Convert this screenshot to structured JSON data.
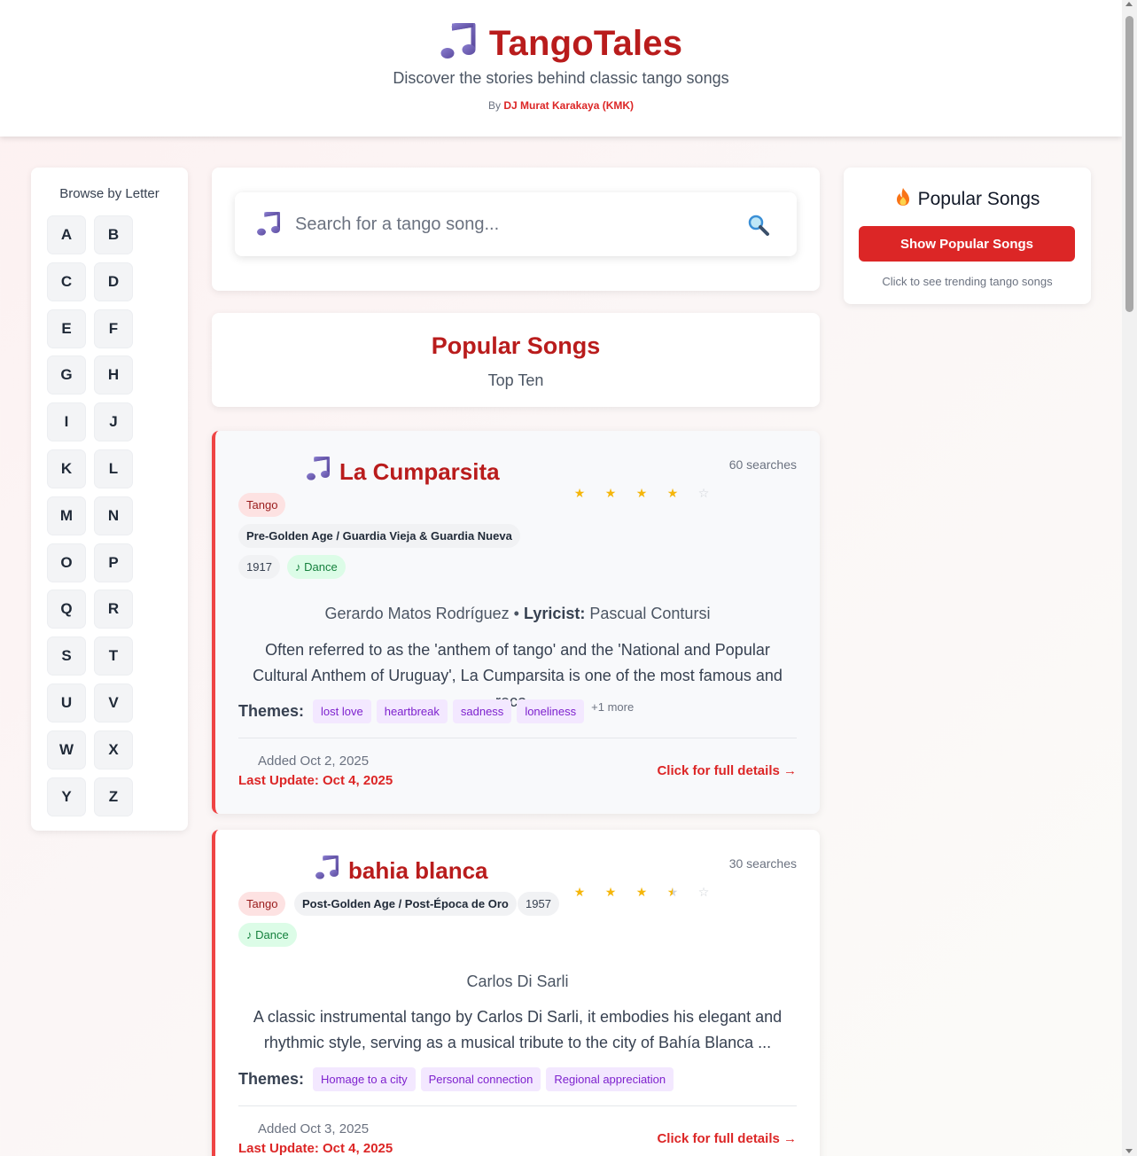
{
  "header": {
    "title": "TangoTales",
    "subtitle": "Discover the stories behind classic tango songs",
    "byline_prefix": "By",
    "author": "DJ Murat Karakaya (KMK)",
    "icon": "music-note-icon"
  },
  "letters": {
    "title": "Browse by Letter",
    "items": [
      "A",
      "B",
      "C",
      "D",
      "E",
      "F",
      "G",
      "H",
      "I",
      "J",
      "K",
      "L",
      "M",
      "N",
      "O",
      "P",
      "Q",
      "R",
      "S",
      "T",
      "U",
      "V",
      "W",
      "X",
      "Y",
      "Z"
    ]
  },
  "search": {
    "placeholder": "Search for a tango song...",
    "value": "",
    "icon": "magnifier-icon"
  },
  "popular_header": {
    "title": "Popular Songs",
    "subtitle": "Top Ten"
  },
  "songs": [
    {
      "title": "La Cumparsita",
      "searches": "60 searches",
      "rating": 4,
      "genre": "Tango",
      "era": "Pre-Golden Age / Guardia Vieja & Guardia Nueva",
      "year": "1917",
      "dance": "♪ Dance",
      "composer": "Gerardo Matos Rodríguez",
      "separator": "•",
      "lyricist_label": "Lyricist:",
      "lyricist": "Pascual Contursi",
      "description": "Often referred to as the 'anthem of tango' and the 'National and Popular Cultural Anthem of Uruguay', La Cumparsita is one of the most famous and reco...",
      "themes_label": "Themes:",
      "themes": [
        "lost love",
        "heartbreak",
        "sadness",
        "loneliness"
      ],
      "more": "+1 more",
      "added": "Added Oct 2, 2025",
      "updated": "Last Update: Oct 4, 2025",
      "details": "Click for full details →"
    },
    {
      "title": "bahia blanca",
      "searches": "30 searches",
      "rating": 3.5,
      "genre": "Tango",
      "era": "Post-Golden Age / Post-Época de Oro",
      "year": "1957",
      "dance": "♪ Dance",
      "composer": "Carlos Di Sarli",
      "description": "A classic instrumental tango by Carlos Di Sarli, it embodies his elegant and rhythmic style, serving as a musical tribute to the city of Bahía Blanca ...",
      "themes_label": "Themes:",
      "themes": [
        "Homage to a city",
        "Personal connection",
        "Regional appreciation"
      ],
      "added": "Added Oct 3, 2025",
      "updated": "Last Update: Oct 4, 2025",
      "details": "Click for full details →"
    }
  ],
  "popular_side": {
    "title": "Popular Songs",
    "icon": "fire-icon",
    "button": "Show Popular Songs",
    "hint": "Click to see trending tango songs"
  },
  "colors": {
    "brand_red": "#b91c1c",
    "accent_red": "#dc2626",
    "note_purple": "#6d5bb0",
    "star_gold": "#f5b60a",
    "theme_purple_bg": "#f3e8ff",
    "dance_green_bg": "#dcfce7"
  }
}
